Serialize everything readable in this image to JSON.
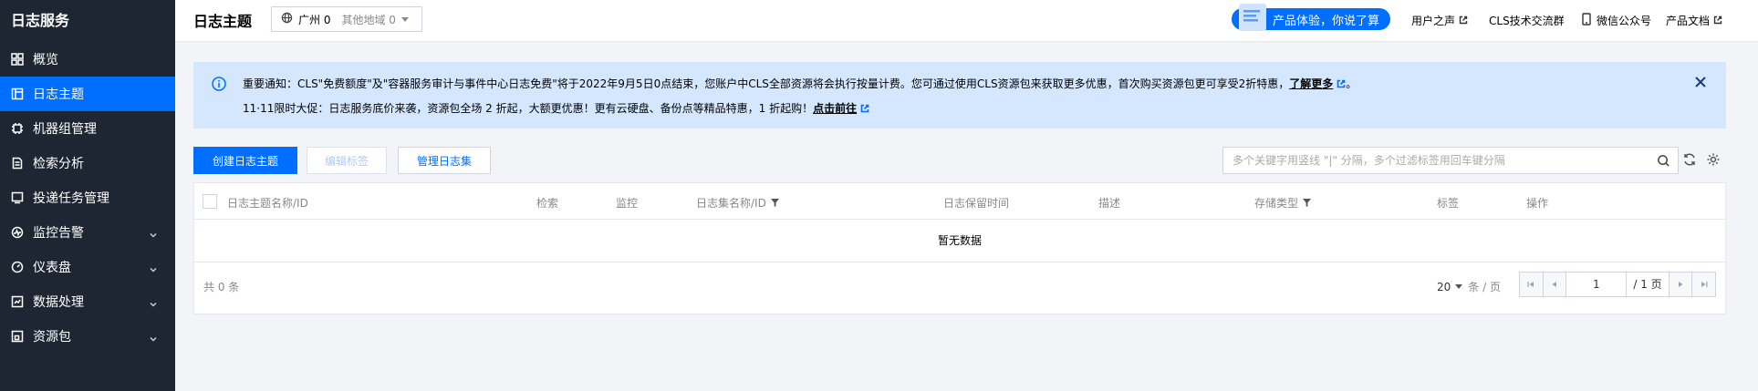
{
  "sidebar": {
    "brand": "日志服务",
    "items": [
      {
        "label": "概览",
        "icon": "grid-icon",
        "active": false,
        "expandable": false
      },
      {
        "label": "日志主题",
        "icon": "topic-icon",
        "active": true,
        "expandable": false
      },
      {
        "label": "机器组管理",
        "icon": "chip-icon",
        "active": false,
        "expandable": false
      },
      {
        "label": "检索分析",
        "icon": "document-icon",
        "active": false,
        "expandable": false
      },
      {
        "label": "投递任务管理",
        "icon": "delivery-icon",
        "active": false,
        "expandable": false
      },
      {
        "label": "监控告警",
        "icon": "pulse-icon",
        "active": false,
        "expandable": true
      },
      {
        "label": "仪表盘",
        "icon": "gauge-icon",
        "active": false,
        "expandable": true
      },
      {
        "label": "数据处理",
        "icon": "processing-icon",
        "active": false,
        "expandable": true
      },
      {
        "label": "资源包",
        "icon": "package-icon",
        "active": false,
        "expandable": true
      }
    ]
  },
  "header": {
    "title": "日志主题",
    "region_current": "广州 0",
    "region_other": "其他地域 0",
    "promo": "产品体验，你说了算",
    "links": [
      "用户之声",
      "CLS技术交流群",
      "微信公众号",
      "产品文档"
    ]
  },
  "notice": {
    "line1_text": "重要通知：CLS\"免费额度\"及\"容器服务审计与事件中心日志免费\"将于2022年9月5日0点结束，您账户中CLS全部资源将会执行按量计费。您可通过使用CLS资源包来获取更多优惠，首次购买资源包更可享受2折特惠，",
    "line1_link": "了解更多",
    "line1_end": "。",
    "line2_text": "11·11限时大促：日志服务底价来袭，资源包全场 2 折起，大额更优惠！更有云硬盘、备份点等精品特惠，1 折起购！",
    "line2_link": "点击前往"
  },
  "toolbar": {
    "create": "创建日志主题",
    "edit_tags": "编辑标签",
    "manage_sets": "管理日志集",
    "search_placeholder": "多个关键字用竖线 \"|\" 分隔，多个过滤标签用回车键分隔"
  },
  "table": {
    "columns": [
      "日志主题名称/ID",
      "检索",
      "监控",
      "日志集名称/ID",
      "日志保留时间",
      "描述",
      "存储类型",
      "标签",
      "操作"
    ],
    "empty": "暂无数据",
    "total": "共 0 条",
    "page_size": "20",
    "page_size_unit": "条 / 页",
    "current_page": "1",
    "total_pages": "/ 1 页"
  },
  "colors": {
    "sidebar_bg": "#1f2633",
    "accent": "#006eff",
    "notice_bg": "#d5e7ff"
  }
}
